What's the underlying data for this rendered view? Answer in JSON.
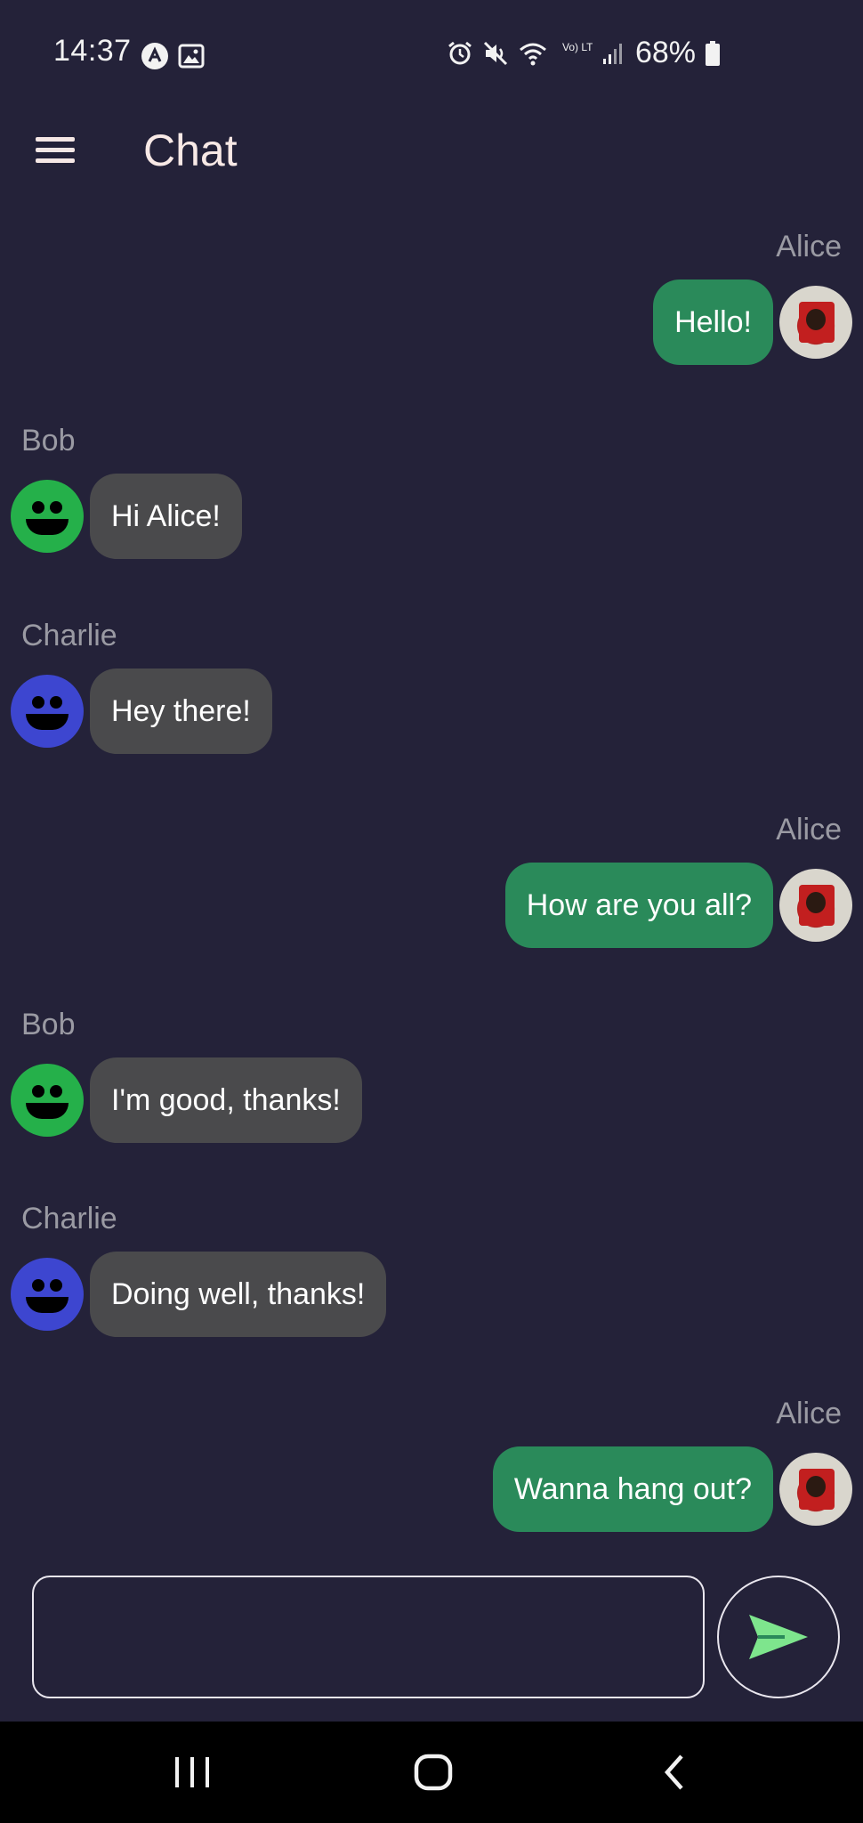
{
  "status_bar": {
    "time": "14:37",
    "battery_text": "68%",
    "left_icons": [
      "app-notification-icon",
      "gallery-icon"
    ],
    "right_icons": [
      "alarm-icon",
      "mute-icon",
      "wifi-icon",
      "volte-icon",
      "signal-icon",
      "battery-icon"
    ],
    "network_label": "Vo) LTE1"
  },
  "header": {
    "title": "Chat",
    "menu_icon": "hamburger-menu-icon"
  },
  "messages": [
    {
      "sender": "Alice",
      "text": "Hello!",
      "outgoing": true,
      "avatar": "alice-photo"
    },
    {
      "sender": "Bob",
      "text": "Hi Alice!",
      "outgoing": false,
      "avatar": "smiley-green"
    },
    {
      "sender": "Charlie",
      "text": "Hey there!",
      "outgoing": false,
      "avatar": "smiley-blue"
    },
    {
      "sender": "Alice",
      "text": "How are you all?",
      "outgoing": true,
      "avatar": "alice-photo"
    },
    {
      "sender": "Bob",
      "text": "I'm good, thanks!",
      "outgoing": false,
      "avatar": "smiley-green"
    },
    {
      "sender": "Charlie",
      "text": "Doing well, thanks!",
      "outgoing": false,
      "avatar": "smiley-blue"
    },
    {
      "sender": "Alice",
      "text": "Wanna hang out?",
      "outgoing": true,
      "avatar": "alice-photo"
    }
  ],
  "composer": {
    "value": "",
    "placeholder": "",
    "send_icon": "send-arrow-icon"
  },
  "nav_bar": {
    "icons": [
      "recent-apps-icon",
      "home-icon",
      "back-icon"
    ]
  },
  "colors": {
    "background": "#242239",
    "outgoing_bubble": "#2a8a5a",
    "incoming_bubble": "#4a4a4c",
    "bob_avatar": "#25b04a",
    "charlie_avatar": "#3d46d0",
    "send_arrow": "#7ee58d"
  }
}
